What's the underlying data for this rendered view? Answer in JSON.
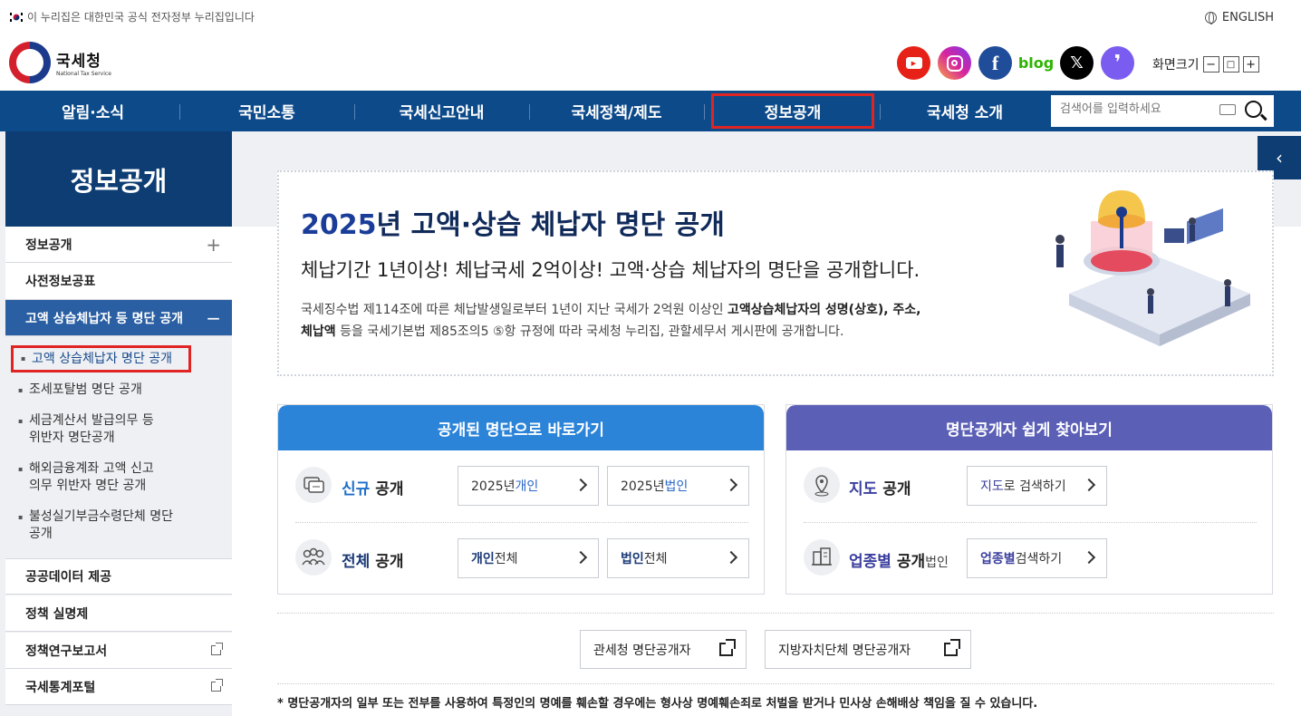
{
  "topbar": {
    "gov_notice": "이 누리집은 대한민국 공식 전자정부 누리집입니다",
    "english": "ENGLISH"
  },
  "logo": {
    "name": "국세청",
    "sub": "National Tax Service"
  },
  "sns": [
    {
      "name": "youtube",
      "glyph": "▶",
      "color": "#e62117"
    },
    {
      "name": "instagram",
      "glyph": "◎",
      "color": "#d6249f"
    },
    {
      "name": "facebook",
      "glyph": "f",
      "color": "#1f4d9a"
    },
    {
      "name": "blog",
      "glyph": "blog",
      "color": "#2db400"
    },
    {
      "name": "x",
      "glyph": "X",
      "color": "#000000"
    },
    {
      "name": "kakao",
      "glyph": "❜",
      "color": "#7b5cf0"
    }
  ],
  "zoom": {
    "label": "화면크기",
    "minus": "−",
    "reset": "□",
    "plus": "+"
  },
  "gnb": [
    {
      "label": "알림·소식"
    },
    {
      "label": "국민소통"
    },
    {
      "label": "국세신고안내"
    },
    {
      "label": "국세정책/제도"
    },
    {
      "label": "정보공개"
    },
    {
      "label": "국세청 소개"
    }
  ],
  "search": {
    "placeholder": "검색어를 입력하세요"
  },
  "side": {
    "title": "정보공개",
    "items": [
      {
        "label": "정보공개",
        "mark": "+"
      },
      {
        "label": "사전정보공표"
      },
      {
        "label": "고액 상습체납자 등 명단 공개",
        "mark": "−"
      }
    ],
    "sub": [
      "고액 상습체납자 명단 공개",
      "조세포탈범 명단 공개",
      "세금계산서 발급의무 등",
      "위반자 명단공개",
      "해외금융계좌 고액 신고",
      "의무 위반자 명단 공개",
      "불성실기부금수령단체 명단",
      "공개"
    ],
    "bottom": [
      {
        "label": "공공데이터 제공"
      },
      {
        "label": "정책 실명제"
      },
      {
        "label": "정책연구보고서"
      },
      {
        "label": "국세통계포털"
      }
    ]
  },
  "banner": {
    "title_year": "2025",
    "title_rest": "년 고액·상습 체납자 명단 공개",
    "subtitle": "체납기간 1년이상! 체납국세 2억이상! 고액·상습 체납자의 명단을 공개합니다.",
    "desc_1": "국세징수법 제114조에 따른 체납발생일로부터 1년이 지난 국세가 2억원 이상인 ",
    "desc_bold_1": "고액상습체납자의 성명(상호), 주소,",
    "desc_bold_2": "체납액",
    "desc_2": " 등을 국세기본법 제85조의5 ⑤항 규정에 따라 국세청 누리집, 관할세무서 게시판에 공개합니다."
  },
  "left_box": {
    "title": "공개된 명단으로 바로가기",
    "color": "#2b84d8",
    "row1": {
      "label_hl": "신규",
      "label": " 공개",
      "btn1_a": "2025년 ",
      "btn1_b": "개인",
      "btn2_a": "2025년 ",
      "btn2_b": "법인"
    },
    "row2": {
      "label_hl": "전체",
      "label": " 공개",
      "btn1_a": "개인",
      "btn1_b": " 전체",
      "btn2_a": "법인",
      "btn2_b": " 전체"
    }
  },
  "right_box": {
    "title": "명단공개자 쉽게 찾아보기",
    "color": "#5b5fb5",
    "row1": {
      "label_hl": "지도",
      "label": " 공개",
      "btn_a": "지도",
      "btn_b": "로 검색하기"
    },
    "row2": {
      "label_hl": "업종별",
      "label": " 공개",
      "label_small": "법인",
      "btn_a": "업종별",
      "btn_b": " 검색하기"
    }
  },
  "links": [
    {
      "label": "관세청 명단공개자"
    },
    {
      "label": "지방자치단체 명단공개자"
    }
  ],
  "notice": "* 명단공개자의 일부 또는 전부를 사용하여 특정인의 명예를 훼손할 경우에는 형사상 명예훼손죄로 처벌을 받거나 민사상 손해배상 책임을 질 수 있습니다."
}
